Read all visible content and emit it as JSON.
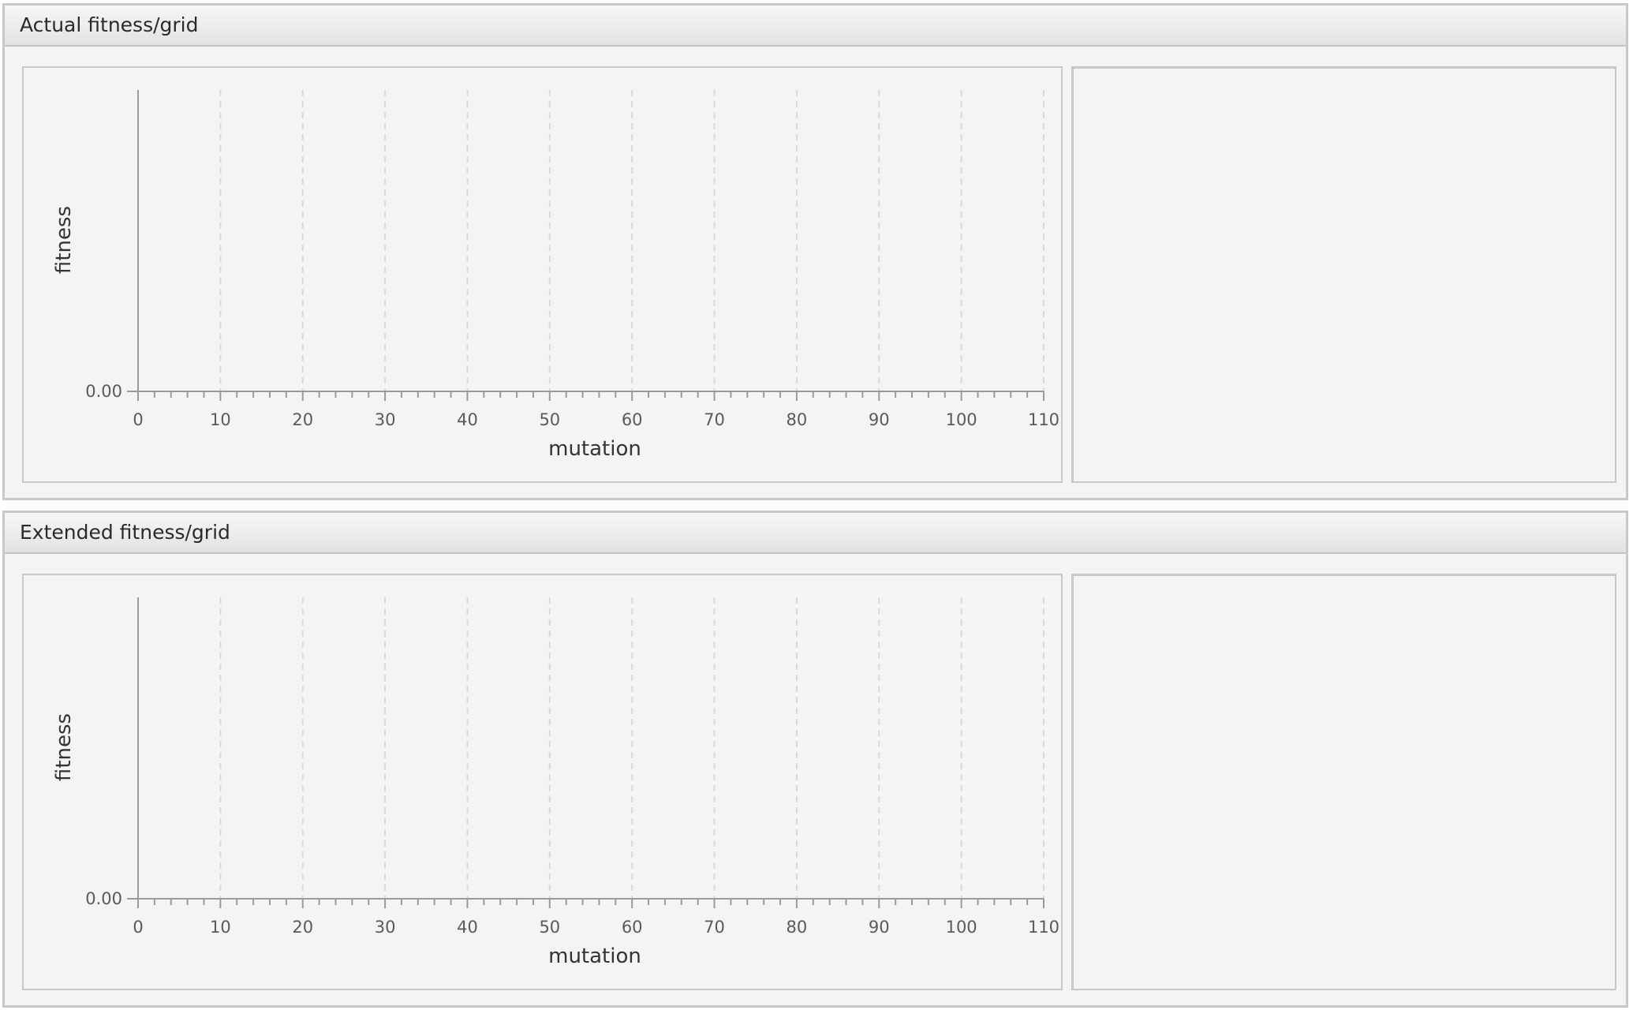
{
  "panels": [
    {
      "title": "Actual fitness/grid",
      "chart_data": {
        "type": "line",
        "xlabel": "mutation",
        "ylabel": "fitness",
        "xlim": [
          0,
          110
        ],
        "x_ticks": [
          "0",
          "10",
          "20",
          "30",
          "40",
          "50",
          "60",
          "70",
          "80",
          "90",
          "100",
          "110"
        ],
        "y_ticks": [
          "0.00"
        ],
        "series": [],
        "vertical_grid": true,
        "grid_style": "dashed"
      }
    },
    {
      "title": "Extended fitness/grid",
      "chart_data": {
        "type": "line",
        "xlabel": "mutation",
        "ylabel": "fitness",
        "xlim": [
          0,
          110
        ],
        "x_ticks": [
          "0",
          "10",
          "20",
          "30",
          "40",
          "50",
          "60",
          "70",
          "80",
          "90",
          "100",
          "110"
        ],
        "y_ticks": [
          "0.00"
        ],
        "series": [],
        "vertical_grid": true,
        "grid_style": "dashed"
      }
    }
  ],
  "colors": {
    "background": "#f4f4f4",
    "border": "#c8c8c8",
    "axis": "#9a9a9a",
    "grid": "#d9d9d9",
    "tick_text": "#5a5a5a",
    "label_text": "#333333"
  }
}
